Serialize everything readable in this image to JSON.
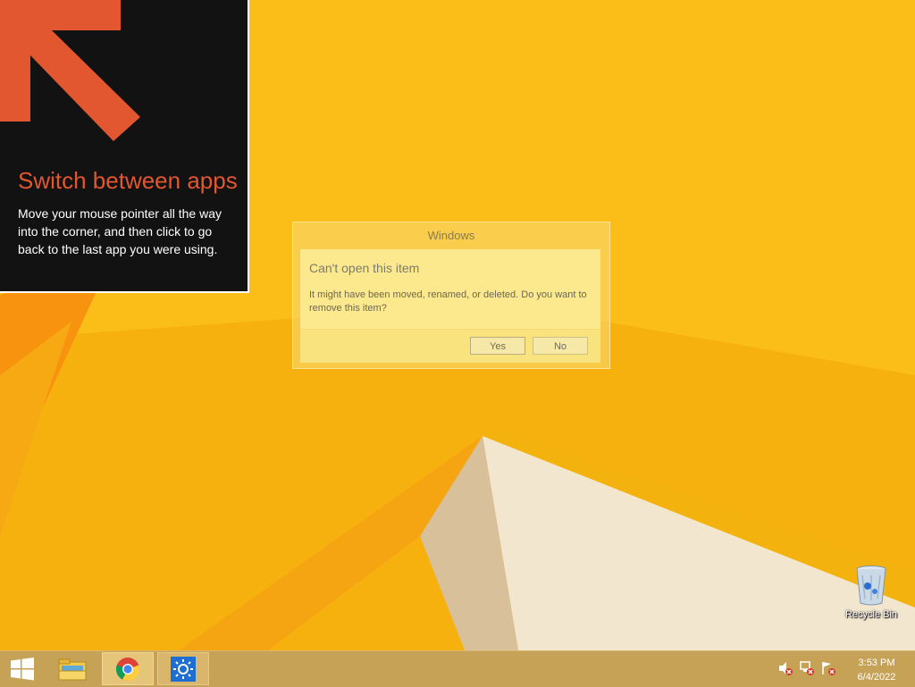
{
  "tip": {
    "title": "Switch between apps",
    "body": "Move your mouse pointer all the way into the corner, and then click to go back to the last app you were using."
  },
  "dialog": {
    "title": "Windows",
    "header": "Can't open this item",
    "message": "It might have been moved, renamed, or deleted. Do you want to remove this item?",
    "yes_label": "Yes",
    "no_label": "No"
  },
  "desktop": {
    "recycle_bin_label": "Recycle Bin"
  },
  "taskbar": {
    "items": [
      {
        "name": "file-explorer",
        "icon": "folder-icon"
      },
      {
        "name": "chrome",
        "icon": "chrome-icon"
      },
      {
        "name": "brightness",
        "icon": "sun-icon"
      }
    ],
    "tray_icons": [
      "volume-muted-icon",
      "network-error-icon",
      "action-center-flag-icon"
    ],
    "time": "3:53 PM",
    "date": "6/4/2022"
  },
  "colors": {
    "accent": "#e2572f",
    "wallpaper": "#f7b10e",
    "taskbar": "#c6a257"
  }
}
